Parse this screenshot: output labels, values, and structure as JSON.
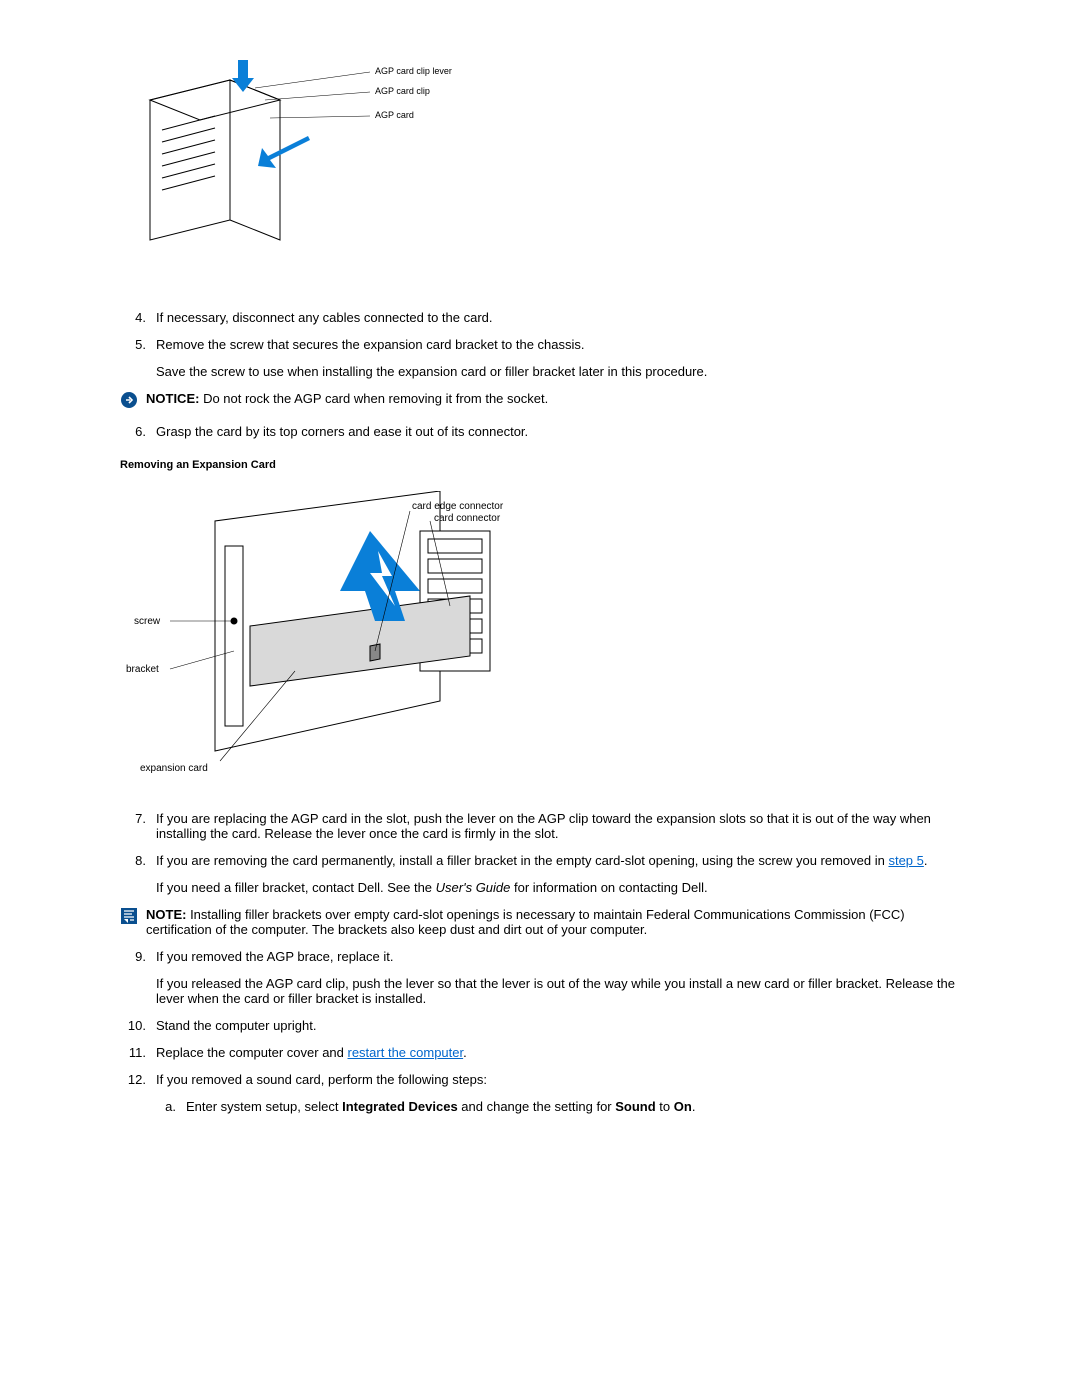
{
  "figure1": {
    "label_lever": "AGP card clip lever",
    "label_clip": "AGP card clip",
    "label_card": "AGP card"
  },
  "step4": {
    "num": "4.",
    "text": "If necessary, disconnect any cables connected to the card."
  },
  "step5": {
    "num": "5.",
    "text": "Remove the screw that secures the expansion card bracket to the chassis.",
    "text2": "Save the screw to use when installing the expansion card or filler bracket later in this procedure."
  },
  "notice1": {
    "bold": "NOTICE:",
    "text": " Do not rock the AGP card when removing it from the socket."
  },
  "step6": {
    "num": "6.",
    "text": "Grasp the card by its top corners and ease it out of its connector."
  },
  "figure2": {
    "caption": "Removing an Expansion Card",
    "label_edge": "card edge connector",
    "label_conn": "card connector",
    "label_screw": "screw",
    "label_bracket": "bracket",
    "label_expcard": "expansion card"
  },
  "step7": {
    "num": "7.",
    "text": "If you are replacing the AGP card in the slot, push the lever on the AGP clip toward the expansion slots so that it is out of the way when installing the card. Release the lever once the card is firmly in the slot."
  },
  "step8": {
    "num": "8.",
    "text_before_link": "If you are removing the card permanently, install a filler bracket in the empty card-slot opening, using the screw you removed in ",
    "link": "step 5",
    "after": ".",
    "para2_before": "If you need a filler bracket, contact Dell. See the ",
    "para2_italic": "User's Guide",
    "para2_after": " for information on contacting Dell."
  },
  "note1": {
    "bold": "NOTE:",
    "text": " Installing filler brackets over empty card-slot openings is necessary to maintain Federal Communications Commission (FCC) certification of the computer. The brackets also keep dust and dirt out of your computer."
  },
  "step9": {
    "num": "9.",
    "text": "If you removed the AGP brace, replace it.",
    "text2": "If you released the AGP card clip, push the lever so that the lever is out of the way while you install a new card or filler bracket. Release the lever when the card or filler bracket is installed."
  },
  "step10": {
    "num": "10.",
    "text": "Stand the computer upright."
  },
  "step11": {
    "num": "11.",
    "text_before": "Replace the computer cover and ",
    "link": "restart the computer",
    "after": "."
  },
  "step12": {
    "num": "12.",
    "text": "If you removed a sound card, perform the following steps:",
    "sub_a_letter": "a.",
    "sub_a_before": "Enter system setup, select ",
    "sub_a_bold1": "Integrated Devices",
    "sub_a_mid": " and change the setting for ",
    "sub_a_bold2": "Sound",
    "sub_a_mid2": " to ",
    "sub_a_bold3": "On",
    "sub_a_after": "."
  }
}
